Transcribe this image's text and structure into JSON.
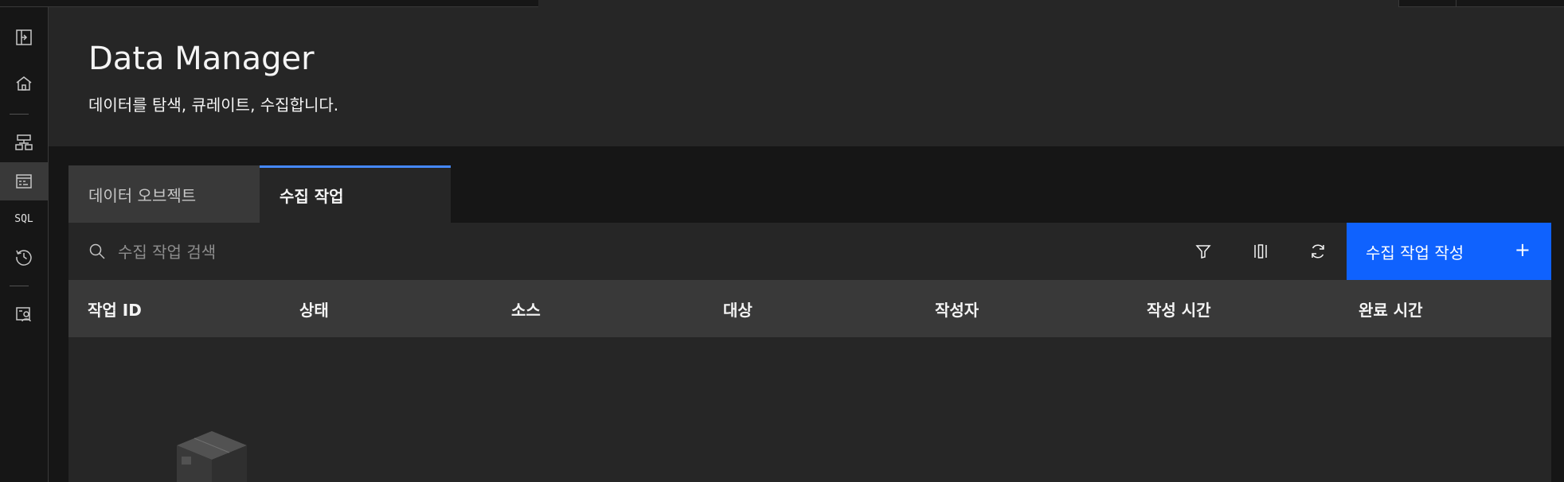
{
  "app": {
    "title": "Data Manager",
    "subtitle": "데이터를 탐색, 큐레이트, 수집합니다."
  },
  "sidebar": {
    "items": [
      {
        "name": "expand-icon"
      },
      {
        "name": "home-icon"
      },
      {
        "name": "structure-icon"
      },
      {
        "name": "data-manager-icon",
        "active": true
      },
      {
        "name": "sql-icon",
        "label": "SQL"
      },
      {
        "name": "history-icon"
      },
      {
        "name": "access-icon"
      }
    ]
  },
  "tabs": [
    {
      "label": "데이터 오브젝트",
      "selected": false
    },
    {
      "label": "수집 작업",
      "selected": true
    }
  ],
  "toolbar": {
    "search_placeholder": "수집 작업 검색",
    "create_label": "수집 작업 작성",
    "plus": "+"
  },
  "table": {
    "columns": [
      "작업 ID",
      "상태",
      "소스",
      "대상",
      "작성자",
      "작성 시간",
      "완료 시간"
    ],
    "rows": []
  },
  "colors": {
    "background": "#161616",
    "surface": "#262626",
    "header_row": "#393939",
    "primary": "#0f62fe",
    "tab_accent": "#4589ff"
  }
}
